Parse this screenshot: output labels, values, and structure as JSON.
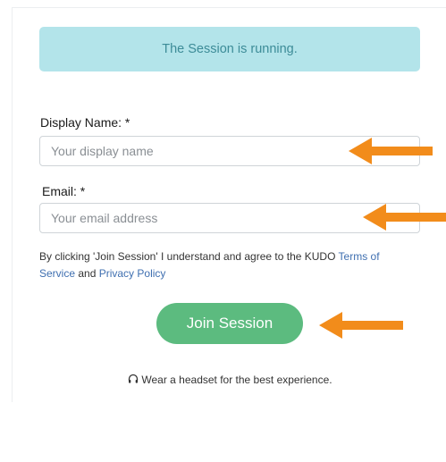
{
  "banner": {
    "text": "The Session is running."
  },
  "form": {
    "display_name_label": "Display Name: *",
    "display_name_placeholder": "Your display name",
    "email_label": "Email: *",
    "email_placeholder": "Your email address",
    "agreement_prefix": "By clicking 'Join Session' I understand and agree to the KUDO ",
    "terms_link": "Terms of Service",
    "agreement_and": " and ",
    "privacy_link": "Privacy Policy",
    "join_label": "Join Session"
  },
  "footer": {
    "headset_text": "Wear a headset for the best experience."
  },
  "icons": {
    "headset": "headphones-icon",
    "annotation": "arrow-left-icon"
  },
  "colors": {
    "banner_bg": "#b3e4ea",
    "banner_text": "#3d8c98",
    "join_button": "#5cbb7f",
    "link": "#3f6fb0",
    "annotation_arrow": "#f28c1b"
  }
}
